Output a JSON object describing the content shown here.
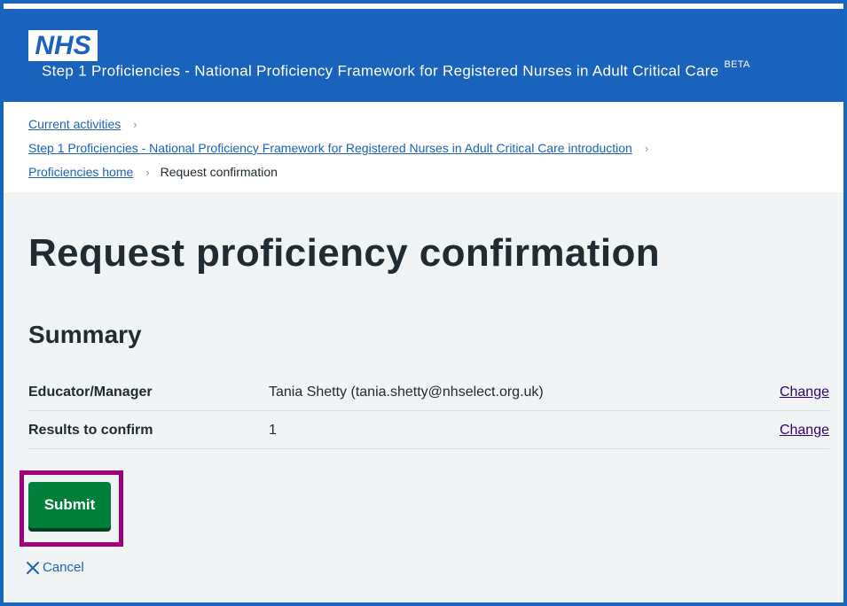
{
  "header": {
    "logo_text": "NHS",
    "service_name": "Step 1 Proficiencies - National Proficiency Framework for Registered Nurses in Adult Critical Care",
    "beta_tag": "BETA"
  },
  "breadcrumbs": {
    "items": [
      {
        "label": "Current activities"
      },
      {
        "label": "Step 1 Proficiencies - National Proficiency Framework for Registered Nurses in Adult Critical Care introduction"
      },
      {
        "label": "Proficiencies home"
      }
    ],
    "current": "Request confirmation",
    "separator": "›"
  },
  "page": {
    "title": "Request proficiency confirmation",
    "summary_heading": "Summary"
  },
  "summary": {
    "rows": [
      {
        "key": "Educator/Manager",
        "value": "Tania Shetty (tania.shetty@nhselect.org.uk)",
        "action": "Change"
      },
      {
        "key": "Results to confirm",
        "value": "1",
        "action": "Change"
      }
    ]
  },
  "actions": {
    "submit_label": "Submit",
    "cancel_label": "Cancel"
  },
  "colors": {
    "brand_blue": "#1a63bc",
    "submit_green": "#007f3b",
    "highlight": "#a0007a",
    "link_visited": "#330072",
    "page_background": "#f0f4f5"
  },
  "icons": {
    "cancel": "close-icon"
  }
}
